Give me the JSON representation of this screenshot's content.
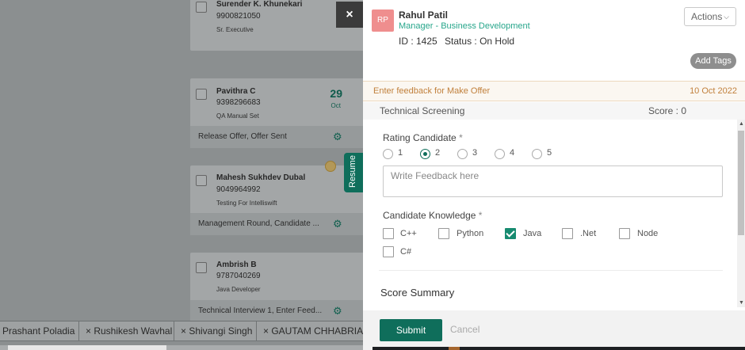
{
  "board": {
    "cards": [
      {
        "name": "Surender K. Khunekari",
        "phone": "9900821050",
        "role": "Sr. Executive"
      },
      {
        "name": "Pavithra C",
        "phone": "9398296683",
        "role": "QA Manual Set",
        "day": "29",
        "month": "Oct",
        "footer": "Release Offer, Offer Sent"
      },
      {
        "name": "Mahesh Sukhdev Dubal",
        "phone": "9049964992",
        "role": "Testing For Intelliswift",
        "footer": "Management Round, Candidate ..."
      },
      {
        "name": "Ambrish B",
        "phone": "9787040269",
        "role": "Java Developer",
        "footer": "Technical Interview 1, Enter Feed..."
      }
    ],
    "resume_tab": "Resume",
    "chips": [
      "Prashant Poladia",
      "× Rushikesh Wavhal",
      "× Shivangi Singh",
      "× GAUTAM CHHABRIA"
    ]
  },
  "close_label": "×",
  "candidate": {
    "initials": "RP",
    "name": "Rahul Patil",
    "title": "Manager - Business Development",
    "id_text": "ID : 1425",
    "status_text": "Status : On Hold",
    "actions_label": "Actions",
    "add_tags_label": "Add Tags"
  },
  "feedback_bar": {
    "label": "Enter feedback for Make Offer",
    "date": "10 Oct 2022"
  },
  "section": {
    "name": "Technical Screening",
    "score": "Score : 0"
  },
  "rating": {
    "label": "Rating Candidate",
    "required": "*",
    "options": [
      "1",
      "2",
      "3",
      "4",
      "5"
    ],
    "selected": "2",
    "feedback_placeholder": "Write Feedback here"
  },
  "knowledge": {
    "label": "Candidate Knowledge",
    "required": "*",
    "options": [
      "C++",
      "Python",
      "Java",
      ".Net",
      "Node",
      "C#"
    ],
    "checked": [
      "Java"
    ]
  },
  "score_summary_label": "Score Summary",
  "footer": {
    "submit_label": "Submit",
    "cancel_label": "Cancel"
  },
  "colors": {
    "primary": "#0f6e5b",
    "accent_green": "#27a68b",
    "feedback_text": "#c1803c",
    "avatar": "#ef8e8e"
  }
}
